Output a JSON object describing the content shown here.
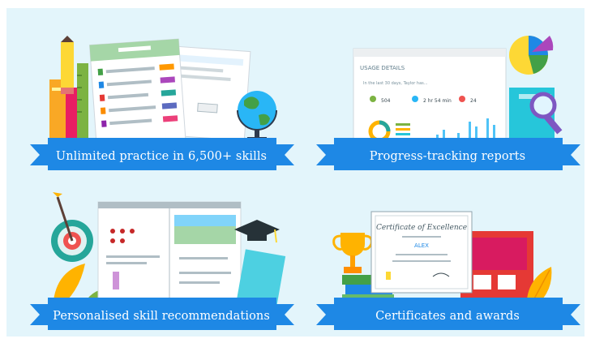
{
  "colors": {
    "panel_background": "#e3f5fb",
    "ribbon_main": "#1e88e5",
    "ribbon_fold": "#0d5fa8",
    "ribbon_text": "#ffffff"
  },
  "cards": [
    {
      "caption": "Unlimited practice in 6,500+ skills",
      "illustration": "practice-worksheets-illustration",
      "icons": [
        "pencil-icon",
        "ruler-icon",
        "globe-icon",
        "books-icon"
      ]
    },
    {
      "caption": "Progress-tracking reports",
      "illustration": "usage-details-report-illustration",
      "icons": [
        "pie-chart-icon",
        "magnifier-icon"
      ]
    },
    {
      "caption": "Personalised skill recommendations",
      "illustration": "recommendations-worksheet-illustration",
      "icons": [
        "target-icon",
        "graduation-cap-icon",
        "leaf-icon"
      ]
    },
    {
      "caption": "Certificates and awards",
      "illustration": "certificate-illustration",
      "icons": [
        "trophy-icon",
        "leaf-icon"
      ]
    }
  ],
  "report": {
    "title": "USAGE DETAILS",
    "intro": "In the last 30 days, Taylor has...",
    "stats": [
      "504",
      "2 hr 54 min",
      "24"
    ]
  },
  "certificate": {
    "title": "Certificate of Excellence",
    "name": "ALEX"
  }
}
